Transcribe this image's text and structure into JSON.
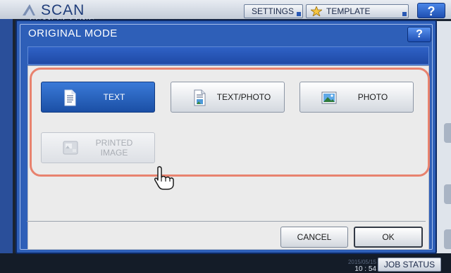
{
  "background": {
    "app_title": "SCAN",
    "subtitle": "SCAN SETTING",
    "settings_label": "SETTINGS",
    "template_label": "TEMPLATE",
    "help_label": "?",
    "clock_time": "10 : 54",
    "clock_date": "2015/05/15",
    "job_status_label": "JOB STATUS"
  },
  "dialog": {
    "title": "ORIGINAL MODE",
    "help_label": "?",
    "modes": [
      {
        "label": "TEXT",
        "icon": "text-document-icon",
        "state": "selected"
      },
      {
        "label": "TEXT/PHOTO",
        "icon": "text-photo-document-icon",
        "state": "normal"
      },
      {
        "label": "PHOTO",
        "icon": "photo-icon",
        "state": "normal"
      },
      {
        "label": "PRINTED\nIMAGE",
        "icon": "printed-image-icon",
        "state": "disabled"
      }
    ],
    "cancel_label": "CANCEL",
    "ok_label": "OK"
  },
  "colors": {
    "dialog_blue": "#2e5fb8",
    "selected_blue": "#1b4fa5",
    "group_outline": "#e8826e"
  }
}
